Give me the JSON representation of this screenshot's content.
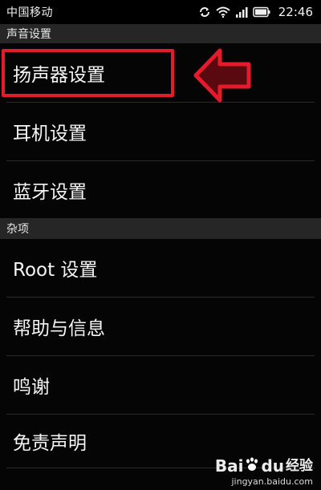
{
  "status_bar": {
    "carrier": "中国移动",
    "time": "22:46",
    "icons": [
      "sync-icon",
      "wifi-icon",
      "signal-icon",
      "battery-icon"
    ]
  },
  "sections": [
    {
      "header": "声音设置",
      "items": [
        {
          "label": "扬声器设置",
          "highlighted": true
        },
        {
          "label": "耳机设置"
        },
        {
          "label": "蓝牙设置"
        }
      ]
    },
    {
      "header": "杂项",
      "items": [
        {
          "label": "Root 设置"
        },
        {
          "label": "帮助与信息"
        },
        {
          "label": "鸣谢"
        },
        {
          "label": "免责声明"
        }
      ]
    }
  ],
  "annotation": {
    "color": "#e31b2a",
    "shape": "arrow-left-icon"
  },
  "watermark": {
    "logo_latin_left": "Bai",
    "logo_latin_right": "du",
    "logo_cn": "经验",
    "url": "jingyan.baidu.com"
  }
}
